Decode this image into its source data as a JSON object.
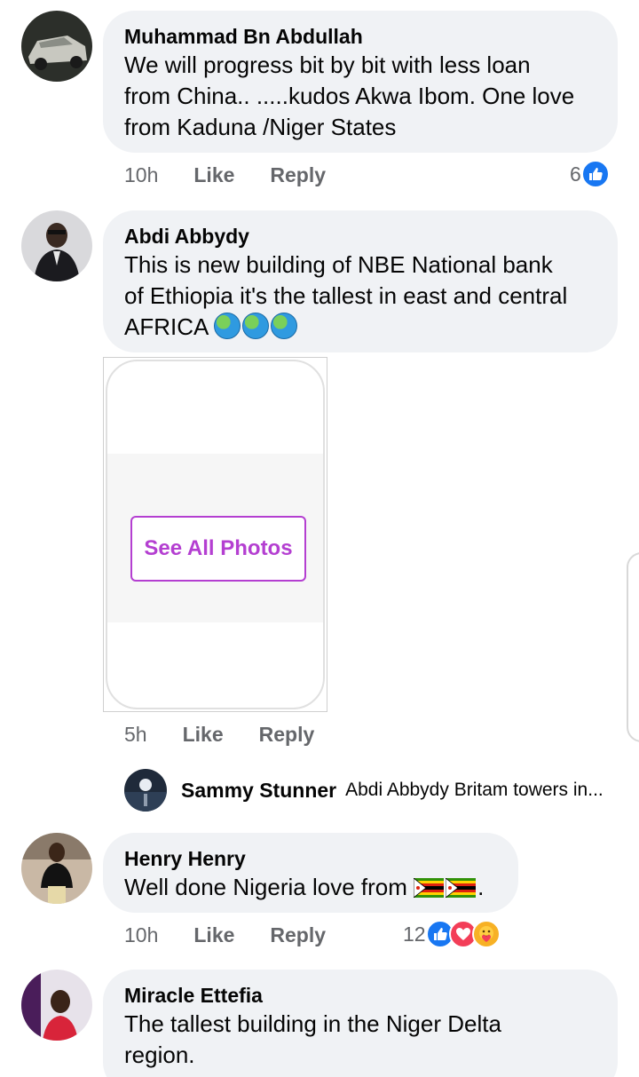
{
  "comments": [
    {
      "author": "Muhammad Bn Abdullah",
      "lines": [
        "We will progress bit by bit with less loan",
        "from China.. .....kudos Akwa Ibom. One love",
        "from Kaduna /Niger States"
      ],
      "time": "10h",
      "like_label": "Like",
      "reply_label": "Reply",
      "reaction_count": "6",
      "reactions": [
        "like-icon"
      ]
    },
    {
      "author": "Abdi Abbydy",
      "lines": [
        "This is new building of NBE National bank",
        "of Ethiopia it's the tallest in east and central",
        "AFRICA"
      ],
      "emoji": [
        "globe-icon",
        "globe-icon",
        "globe-icon"
      ],
      "attachment_button": "See All Photos",
      "time": "5h",
      "like_label": "Like",
      "reply_label": "Reply",
      "reply_preview": {
        "name": "Sammy Stunner",
        "snippet": "Abdi Abbydy Britam towers in..."
      }
    },
    {
      "author": "Henry Henry",
      "text": "Well done Nigeria love from",
      "trailing": ".",
      "emoji": [
        "zimbabwe-flag-icon",
        "zimbabwe-flag-icon"
      ],
      "time": "10h",
      "like_label": "Like",
      "reply_label": "Reply",
      "reaction_count": "12",
      "reactions": [
        "like-icon",
        "love-icon",
        "care-icon"
      ]
    },
    {
      "author": "Miracle Ettefia",
      "lines": [
        "The tallest building in the Niger Delta",
        "region."
      ]
    }
  ],
  "colors": {
    "bubble": "#f0f2f5",
    "meta": "#65676b",
    "like_blue": "#1877f2",
    "love_red": "#f33e58",
    "see_all_purple": "#b43fd1"
  }
}
